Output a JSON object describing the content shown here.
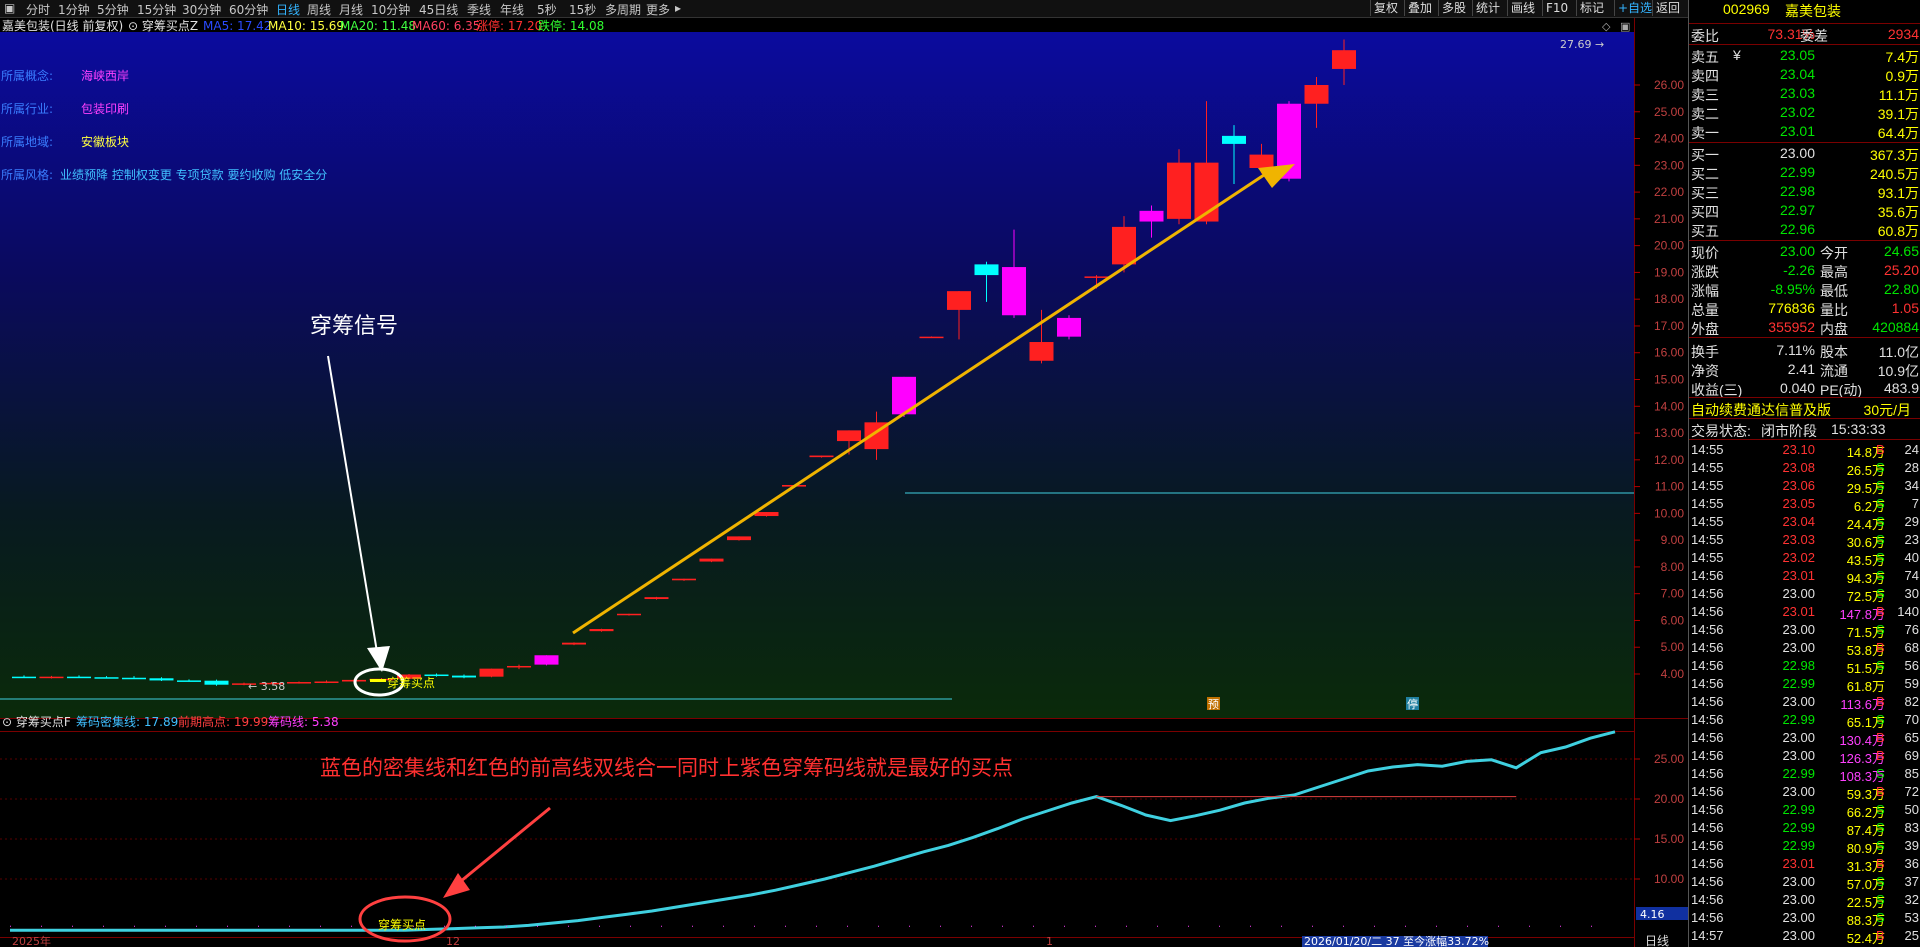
{
  "toolbar": {
    "tabs": [
      "分时",
      "1分钟",
      "5分钟",
      "15分钟",
      "30分钟",
      "60分钟",
      "日线",
      "周线",
      "月线",
      "10分钟",
      "45日线",
      "季线",
      "年线",
      "5秒",
      "15秒",
      "多周期",
      "更多"
    ],
    "active_tab": "日线",
    "right_buttons": [
      "复权",
      "叠加",
      "多股",
      "统计",
      "画线",
      "F10",
      "标记",
      "+自选",
      "返回"
    ]
  },
  "chart_header": {
    "stock": "嘉美包装(日线 前复权)",
    "indicator": "穿筹买点Z",
    "ma5": "MA5: 17.42",
    "ma10": "MA10: 15.69",
    "ma20": "MA20: 11.48",
    "ma60": "MA60: 6.35",
    "limit_up": "涨停: 17.20",
    "limit_down": "跌停: 14.08"
  },
  "info_lines": [
    {
      "label": "所属概念:",
      "value": "海峡西岸"
    },
    {
      "label": "所属行业:",
      "value": "包装印刷"
    },
    {
      "label": "所属地域:",
      "value": "安徽板块"
    },
    {
      "label": "所属风格:",
      "value": "业绩预降 控制权变更 专项贷款 要约收购 低安全分"
    }
  ],
  "annotations": {
    "signal_label": "穿筹信号",
    "marker_label": "穿筹买点",
    "low_price": "3.58",
    "high_price": "27.69",
    "pre_label": "预",
    "stop_label": "停",
    "sub_note": "蓝色的密集线和红色的前高线双线合一同时上紫色穿筹码线就是最好的买点",
    "sub_marker": "穿筹买点"
  },
  "sub_header": {
    "name": "穿筹买点F",
    "dense": "筹码密集线: 17.89",
    "prev_high": "前期高点: 19.99",
    "chip_line": "筹码线: 5.38"
  },
  "axes": {
    "price_ticks": [
      26,
      25,
      24,
      23,
      22,
      21,
      20,
      19,
      18,
      17,
      16,
      15,
      14,
      13,
      12,
      11,
      10,
      9,
      8,
      7,
      6,
      5,
      4
    ],
    "price_tick_labels": [
      "26.00",
      "25.00",
      "24.00",
      "23.00",
      "22.00",
      "21.00",
      "20.00",
      "19.00",
      "18.00",
      "17.00",
      "16.00",
      "15.00",
      "14.00",
      "13.00",
      "12.00",
      "11.00",
      "10.00",
      "9.00",
      "8.00",
      "7.00",
      "6.00",
      "5.00",
      "4.00"
    ],
    "sub_ticks": [
      25,
      20,
      15,
      10
    ],
    "sub_tick_labels": [
      "25.00",
      "20.00",
      "15.00",
      "10.00"
    ],
    "sub_current": "4.16",
    "x_labels": [
      "2025年",
      "12",
      "1"
    ],
    "status_bar": "2026/01/20/二 37 至今涨幅33.72%",
    "period": "日线"
  },
  "chart_data": {
    "type": "candlestick",
    "candles": [
      {
        "o": 3.9,
        "h": 3.95,
        "l": 3.85,
        "c": 3.88
      },
      {
        "o": 3.88,
        "h": 3.93,
        "l": 3.83,
        "c": 3.9
      },
      {
        "o": 3.9,
        "h": 3.95,
        "l": 3.86,
        "c": 3.88
      },
      {
        "o": 3.88,
        "h": 3.92,
        "l": 3.83,
        "c": 3.86
      },
      {
        "o": 3.86,
        "h": 3.92,
        "l": 3.82,
        "c": 3.84
      },
      {
        "o": 3.84,
        "h": 3.88,
        "l": 3.74,
        "c": 3.76
      },
      {
        "o": 3.76,
        "h": 3.8,
        "l": 3.72,
        "c": 3.75
      },
      {
        "o": 3.75,
        "h": 3.79,
        "l": 3.56,
        "c": 3.6
      },
      {
        "o": 3.6,
        "h": 3.68,
        "l": 3.58,
        "c": 3.65
      },
      {
        "o": 3.65,
        "h": 3.7,
        "l": 3.63,
        "c": 3.67
      },
      {
        "o": 3.67,
        "h": 3.72,
        "l": 3.64,
        "c": 3.7
      },
      {
        "o": 3.7,
        "h": 3.76,
        "l": 3.66,
        "c": 3.72
      },
      {
        "o": 3.72,
        "h": 3.8,
        "l": 3.7,
        "c": 3.78
      },
      {
        "o": 3.78,
        "h": 3.85,
        "l": 3.76,
        "c": 3.82
      },
      {
        "o": 3.82,
        "h": 4.0,
        "l": 3.8,
        "c": 3.98
      },
      {
        "o": 3.98,
        "h": 4.02,
        "l": 3.9,
        "c": 3.94
      },
      {
        "o": 3.94,
        "h": 3.98,
        "l": 3.84,
        "c": 3.87
      },
      {
        "o": 3.9,
        "h": 4.2,
        "l": 3.88,
        "c": 4.2
      },
      {
        "o": 4.25,
        "h": 4.35,
        "l": 4.18,
        "c": 4.3
      },
      {
        "o": 4.35,
        "h": 4.7,
        "l": 4.32,
        "c": 4.7
      },
      {
        "o": 5.1,
        "h": 5.18,
        "l": 5.08,
        "c": 5.17
      },
      {
        "o": 5.6,
        "h": 5.69,
        "l": 5.58,
        "c": 5.68
      },
      {
        "o": 6.2,
        "h": 6.25,
        "l": 6.18,
        "c": 6.25
      },
      {
        "o": 6.8,
        "h": 6.88,
        "l": 6.78,
        "c": 6.87
      },
      {
        "o": 7.5,
        "h": 7.56,
        "l": 7.48,
        "c": 7.56
      },
      {
        "o": 8.2,
        "h": 8.31,
        "l": 8.18,
        "c": 8.31
      },
      {
        "o": 9.0,
        "h": 9.14,
        "l": 8.98,
        "c": 9.14
      },
      {
        "o": 9.9,
        "h": 10.05,
        "l": 9.88,
        "c": 10.05
      },
      {
        "o": 11.0,
        "h": 11.06,
        "l": 10.98,
        "c": 11.06
      },
      {
        "o": 12.1,
        "h": 12.16,
        "l": 12.08,
        "c": 12.16
      },
      {
        "o": 12.7,
        "h": 13.1,
        "l": 12.2,
        "c": 13.1
      },
      {
        "o": 12.4,
        "h": 13.8,
        "l": 12.0,
        "c": 13.4
      },
      {
        "o": 13.7,
        "h": 15.1,
        "l": 13.6,
        "c": 15.1
      },
      {
        "o": 16.6,
        "h": 16.61,
        "l": 16.59,
        "c": 16.6
      },
      {
        "o": 17.6,
        "h": 18.3,
        "l": 16.5,
        "c": 18.3
      },
      {
        "o": 19.3,
        "h": 19.4,
        "l": 17.9,
        "c": 18.9
      },
      {
        "o": 17.4,
        "h": 20.6,
        "l": 17.3,
        "c": 19.2
      },
      {
        "o": 15.7,
        "h": 17.6,
        "l": 15.6,
        "c": 16.4
      },
      {
        "o": 16.6,
        "h": 17.4,
        "l": 16.5,
        "c": 17.3
      },
      {
        "o": 18.8,
        "h": 18.9,
        "l": 18.4,
        "c": 18.85
      },
      {
        "o": 19.3,
        "h": 21.1,
        "l": 19.0,
        "c": 20.7
      },
      {
        "o": 20.9,
        "h": 21.5,
        "l": 20.3,
        "c": 21.3
      },
      {
        "o": 21.0,
        "h": 23.6,
        "l": 20.8,
        "c": 23.1
      },
      {
        "o": 20.9,
        "h": 25.4,
        "l": 20.8,
        "c": 23.1
      },
      {
        "o": 24.1,
        "h": 24.5,
        "l": 22.3,
        "c": 23.8
      },
      {
        "o": 22.9,
        "h": 23.8,
        "l": 22.7,
        "c": 23.4
      },
      {
        "o": 22.5,
        "h": 25.4,
        "l": 22.4,
        "c": 25.3
      },
      {
        "o": 25.3,
        "h": 26.3,
        "l": 24.4,
        "c": 26.0
      },
      {
        "o": 26.6,
        "h": 27.7,
        "l": 26.0,
        "c": 27.3
      }
    ],
    "chip_dense_line": [
      3.6,
      3.6,
      3.6,
      3.6,
      3.6,
      3.6,
      3.6,
      3.6,
      3.6,
      3.6,
      3.6,
      3.6,
      3.6,
      3.6,
      3.6,
      3.6,
      3.6,
      3.7,
      3.8,
      3.9,
      4.0,
      4.2,
      4.5,
      4.8,
      5.2,
      5.6,
      6.0,
      6.5,
      7.0,
      7.5,
      8.0,
      8.6,
      9.3,
      10.0,
      10.8,
      11.6,
      12.5,
      13.4,
      14.2,
      15.2,
      16.3,
      17.5,
      18.5,
      19.5,
      20.3,
      19.2,
      18.0,
      17.3,
      17.9,
      18.6,
      19.5,
      20.1,
      20.5,
      21.5,
      22.5,
      23.5,
      24.0,
      24.3,
      24.1,
      24.7,
      24.9,
      23.9,
      25.8,
      26.5,
      27.6,
      28.4
    ]
  },
  "quote": {
    "code": "002969",
    "name": "嘉美包装",
    "committee": {
      "label1": "委比",
      "v1": "73.31%",
      "label2": "委差",
      "v2": "2934"
    },
    "sell": [
      {
        "label": "卖五",
        "flag": "¥",
        "price": "23.05",
        "vol": "7.4万"
      },
      {
        "label": "卖四",
        "flag": "",
        "price": "23.04",
        "vol": "0.9万"
      },
      {
        "label": "卖三",
        "flag": "",
        "price": "23.03",
        "vol": "11.1万"
      },
      {
        "label": "卖二",
        "flag": "",
        "price": "23.02",
        "vol": "39.1万"
      },
      {
        "label": "卖一",
        "flag": "",
        "price": "23.01",
        "vol": "64.4万"
      }
    ],
    "buy": [
      {
        "label": "买一",
        "price": "23.00",
        "vol": "367.3万"
      },
      {
        "label": "买二",
        "price": "22.99",
        "vol": "240.5万"
      },
      {
        "label": "买三",
        "price": "22.98",
        "vol": "93.1万"
      },
      {
        "label": "买四",
        "price": "22.97",
        "vol": "35.6万"
      },
      {
        "label": "买五",
        "price": "22.96",
        "vol": "60.8万"
      }
    ],
    "stats": [
      {
        "l1": "现价",
        "v1": "23.00",
        "l2": "今开",
        "v2": "24.65",
        "c1": "#00e600",
        "c2": "#00e600"
      },
      {
        "l1": "涨跌",
        "v1": "-2.26",
        "l2": "最高",
        "v2": "25.20",
        "c1": "#00e600",
        "c2": "#ff3232"
      },
      {
        "l1": "涨幅",
        "v1": "-8.95%",
        "l2": "最低",
        "v2": "22.80",
        "c1": "#00e600",
        "c2": "#00e600"
      },
      {
        "l1": "总量",
        "v1": "776836",
        "l2": "量比",
        "v2": "1.05",
        "c1": "#ffff00",
        "c2": "#ff3232"
      },
      {
        "l1": "外盘",
        "v1": "355952",
        "l2": "内盘",
        "v2": "420884",
        "c1": "#ff3232",
        "c2": "#00e600"
      },
      {
        "l1": "换手",
        "v1": "7.11%",
        "l2": "股本",
        "v2": "11.0亿",
        "c1": "#e0e0e0",
        "c2": "#e0e0e0"
      },
      {
        "l1": "净资",
        "v1": "2.41",
        "l2": "流通",
        "v2": "10.9亿",
        "c1": "#e0e0e0",
        "c2": "#e0e0e0"
      },
      {
        "l1": "收益(三)",
        "v1": "0.040",
        "l2": "PE(动)",
        "v2": "483.9",
        "c1": "#e0e0e0",
        "c2": "#e0e0e0"
      }
    ],
    "ad_text": "自动续费通达信普及版",
    "ad_price": "30元/月",
    "trade_status_label": "交易状态:",
    "trade_status": "闭市阶段",
    "trade_time": "15:33:33",
    "ticks": [
      {
        "t": "14:55",
        "p": "23.10",
        "v": "14.8万",
        "bs": "B",
        "n": "24"
      },
      {
        "t": "14:55",
        "p": "23.08",
        "v": "26.5万",
        "bs": "S",
        "n": "28"
      },
      {
        "t": "14:55",
        "p": "23.06",
        "v": "29.5万",
        "bs": "S",
        "n": "34"
      },
      {
        "t": "14:55",
        "p": "23.05",
        "v": "6.2万",
        "bs": "S",
        "n": "7"
      },
      {
        "t": "14:55",
        "p": "23.04",
        "v": "24.4万",
        "bs": "S",
        "n": "29"
      },
      {
        "t": "14:55",
        "p": "23.03",
        "v": "30.6万",
        "bs": "S",
        "n": "23"
      },
      {
        "t": "14:55",
        "p": "23.02",
        "v": "43.5万",
        "bs": "S",
        "n": "40"
      },
      {
        "t": "14:56",
        "p": "23.01",
        "v": "94.3万",
        "bs": "S",
        "n": "74"
      },
      {
        "t": "14:56",
        "p": "23.00",
        "v": "72.5万",
        "bs": "S",
        "n": "30"
      },
      {
        "t": "14:56",
        "p": "23.01",
        "v": "147.8万",
        "bs": "B",
        "n": "140"
      },
      {
        "t": "14:56",
        "p": "23.00",
        "v": "71.5万",
        "bs": "S",
        "n": "76"
      },
      {
        "t": "14:56",
        "p": "23.00",
        "v": "53.8万",
        "bs": "B",
        "n": "68"
      },
      {
        "t": "14:56",
        "p": "22.98",
        "v": "51.5万",
        "bs": "S",
        "n": "56"
      },
      {
        "t": "14:56",
        "p": "22.99",
        "v": "61.8万",
        "bs": "",
        "n": "59"
      },
      {
        "t": "14:56",
        "p": "23.00",
        "v": "113.6万",
        "bs": "B",
        "n": "82"
      },
      {
        "t": "14:56",
        "p": "22.99",
        "v": "65.1万",
        "bs": "S",
        "n": "70"
      },
      {
        "t": "14:56",
        "p": "23.00",
        "v": "130.4万",
        "bs": "B",
        "n": "65"
      },
      {
        "t": "14:56",
        "p": "23.00",
        "v": "126.3万",
        "bs": "B",
        "n": "69"
      },
      {
        "t": "14:56",
        "p": "22.99",
        "v": "108.3万",
        "bs": "S",
        "n": "85"
      },
      {
        "t": "14:56",
        "p": "23.00",
        "v": "59.3万",
        "bs": "B",
        "n": "72"
      },
      {
        "t": "14:56",
        "p": "22.99",
        "v": "66.2万",
        "bs": "S",
        "n": "50"
      },
      {
        "t": "14:56",
        "p": "22.99",
        "v": "87.4万",
        "bs": "S",
        "n": "83"
      },
      {
        "t": "14:56",
        "p": "22.99",
        "v": "80.9万",
        "bs": "S",
        "n": "39"
      },
      {
        "t": "14:56",
        "p": "23.01",
        "v": "31.3万",
        "bs": "B",
        "n": "36"
      },
      {
        "t": "14:56",
        "p": "23.00",
        "v": "57.0万",
        "bs": "S",
        "n": "37"
      },
      {
        "t": "14:56",
        "p": "23.00",
        "v": "22.5万",
        "bs": "S",
        "n": "32"
      },
      {
        "t": "14:56",
        "p": "23.00",
        "v": "88.3万",
        "bs": "S",
        "n": "53"
      },
      {
        "t": "14:57",
        "p": "23.00",
        "v": "52.4万",
        "bs": "B",
        "n": "25"
      }
    ]
  },
  "colors": {
    "up": "#ff2020",
    "down": "#00ffff",
    "magenta": "#ff00ff",
    "line_cyan": "#3fd0e0",
    "arrow_gold": "#f0b400",
    "sub_red": "#e04040"
  }
}
